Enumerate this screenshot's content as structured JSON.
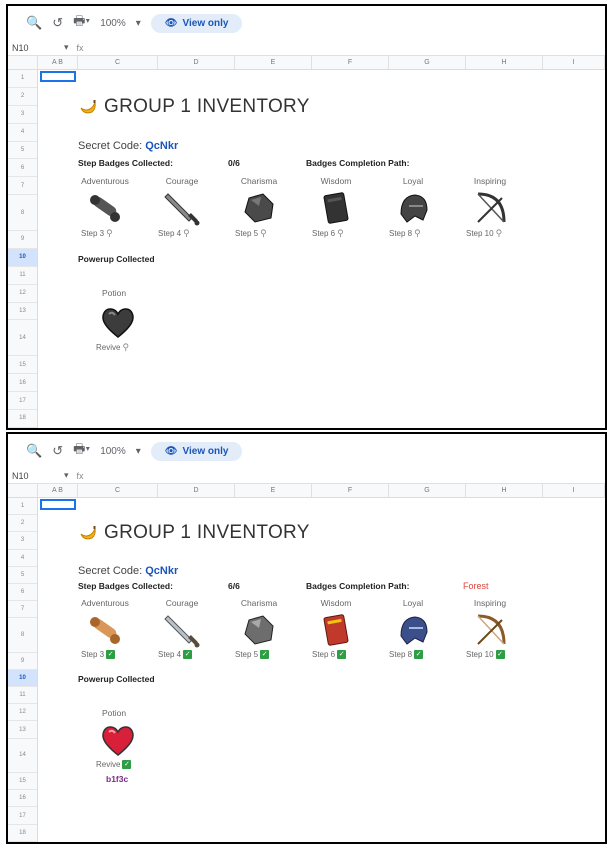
{
  "toolbar": {
    "zoom": "100%",
    "view_only": "View only"
  },
  "formula_bar": {
    "cell_ref": "N10",
    "fx": "fx"
  },
  "columns": [
    "A B",
    "C",
    "D",
    "E",
    "F",
    "G",
    "H",
    "I"
  ],
  "rows": [
    "1",
    "2",
    "3",
    "4",
    "5",
    "6",
    "7",
    "8",
    "9",
    "10",
    "11",
    "12",
    "13",
    "14",
    "15",
    "16",
    "17",
    "18"
  ],
  "selected_row": "10",
  "inventory_title": "GROUP 1 INVENTORY",
  "secret_label": "Secret Code:",
  "secret_code": "QcNkr",
  "step_badges_label": "Step Badges Collected:",
  "badges_path_label": "Badges Completion Path:",
  "powerup_label": "Powerup Collected",
  "potion_label": "Potion",
  "badges": [
    {
      "name": "Adventurous",
      "step": "Step 3",
      "icon": "scroll-icon"
    },
    {
      "name": "Courage",
      "step": "Step 4",
      "icon": "sword-icon"
    },
    {
      "name": "Charisma",
      "step": "Step 5",
      "icon": "stone-icon"
    },
    {
      "name": "Wisdom",
      "step": "Step 6",
      "icon": "book-icon"
    },
    {
      "name": "Loyal",
      "step": "Step 8",
      "icon": "helmet-icon"
    },
    {
      "name": "Inspiring",
      "step": "Step 10",
      "icon": "bow-icon"
    }
  ],
  "before": {
    "count": "0/6",
    "path": "",
    "revive": "Revive"
  },
  "after": {
    "count": "6/6",
    "path": "Forest",
    "revive": "Revive",
    "hash": "b1f3c"
  },
  "colors": {
    "accent": "#1a56b8",
    "check": "#2e9e44",
    "forest": "#e0443a"
  }
}
